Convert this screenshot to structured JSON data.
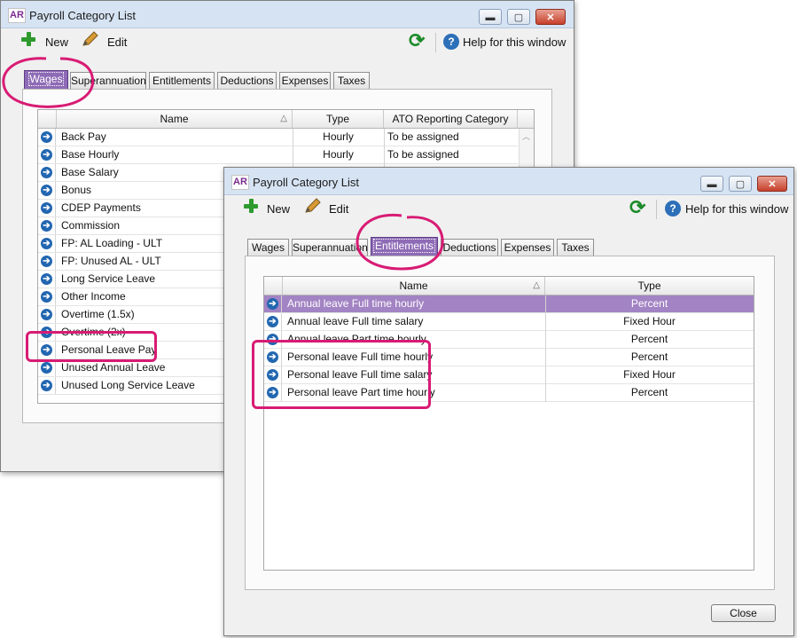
{
  "back_window": {
    "app_logo": "AR",
    "title": "Payroll Category List",
    "toolbar": {
      "new_label": "New",
      "edit_label": "Edit",
      "help_label": "Help for this window"
    },
    "tabs": [
      "Wages",
      "Superannuation",
      "Entitlements",
      "Deductions",
      "Expenses",
      "Taxes"
    ],
    "active_tab": "Wages",
    "columns": [
      "Name",
      "Type",
      "ATO Reporting Category"
    ],
    "rows": [
      {
        "name": "Back Pay",
        "type": "Hourly",
        "ato": "To be assigned"
      },
      {
        "name": "Base Hourly",
        "type": "Hourly",
        "ato": "To be assigned"
      },
      {
        "name": "Base Salary",
        "type": "",
        "ato": ""
      },
      {
        "name": "Bonus",
        "type": "",
        "ato": ""
      },
      {
        "name": "CDEP Payments",
        "type": "",
        "ato": ""
      },
      {
        "name": "Commission",
        "type": "",
        "ato": ""
      },
      {
        "name": "FP: AL Loading - ULT",
        "type": "",
        "ato": ""
      },
      {
        "name": "FP: Unused AL - ULT",
        "type": "",
        "ato": ""
      },
      {
        "name": "Long Service Leave",
        "type": "",
        "ato": ""
      },
      {
        "name": "Other Income",
        "type": "",
        "ato": ""
      },
      {
        "name": "Overtime (1.5x)",
        "type": "",
        "ato": ""
      },
      {
        "name": "Overtime (2x)",
        "type": "",
        "ato": ""
      },
      {
        "name": "Personal Leave Pay",
        "type": "",
        "ato": ""
      },
      {
        "name": "Unused Annual Leave",
        "type": "",
        "ato": ""
      },
      {
        "name": "Unused Long Service Leave",
        "type": "",
        "ato": ""
      }
    ]
  },
  "front_window": {
    "app_logo": "AR",
    "title": "Payroll Category List",
    "toolbar": {
      "new_label": "New",
      "edit_label": "Edit",
      "help_label": "Help for this window"
    },
    "tabs": [
      "Wages",
      "Superannuation",
      "Entitlements",
      "Deductions",
      "Expenses",
      "Taxes"
    ],
    "active_tab": "Entitlements",
    "columns": [
      "Name",
      "Type"
    ],
    "rows": [
      {
        "name": "Annual leave Full time hourly",
        "type": "Percent"
      },
      {
        "name": "Annual leave Full time salary",
        "type": "Fixed Hour"
      },
      {
        "name": "Annual leave Part time hourly",
        "type": "Percent"
      },
      {
        "name": "Personal leave Full time hourly",
        "type": "Percent"
      },
      {
        "name": "Personal leave Full time salary",
        "type": "Fixed Hour"
      },
      {
        "name": "Personal leave Part time hourly",
        "type": "Percent"
      }
    ],
    "selected_row": 0,
    "close_label": "Close"
  },
  "window_controls": {
    "minimize": "▬",
    "maximize": "▢",
    "close": "✕"
  },
  "colors": {
    "accent_purple": "#8e6bb6",
    "selection": "#a283c3",
    "annotation": "#d81b74",
    "toolbar_green": "#2e9a2e",
    "help_blue": "#2d6fb8"
  }
}
